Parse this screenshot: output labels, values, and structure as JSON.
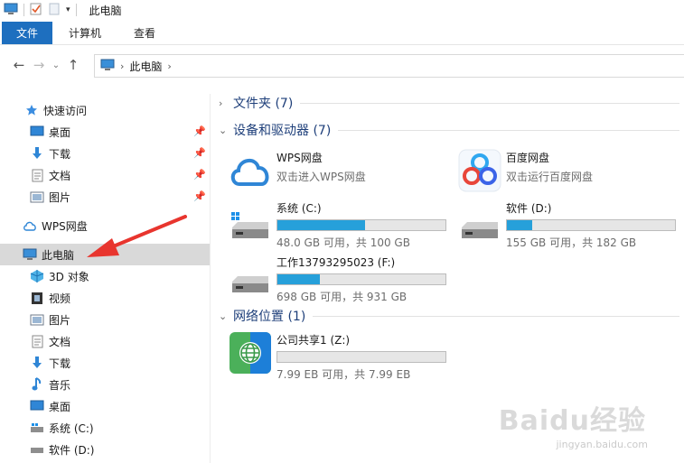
{
  "window": {
    "title": "此电脑"
  },
  "ribbon": {
    "tabs": [
      "文件",
      "计算机",
      "查看"
    ]
  },
  "address": {
    "crumb": "此电脑"
  },
  "sidebar": {
    "quick_access": "快速访问",
    "quick_items": [
      {
        "label": "桌面",
        "icon": "desktop-icon"
      },
      {
        "label": "下载",
        "icon": "download-icon"
      },
      {
        "label": "文档",
        "icon": "document-icon"
      },
      {
        "label": "图片",
        "icon": "pictures-icon"
      }
    ],
    "wps": "WPS网盘",
    "this_pc": "此电脑",
    "pc_items": [
      {
        "label": "3D 对象",
        "icon": "3d-objects-icon"
      },
      {
        "label": "视频",
        "icon": "video-icon"
      },
      {
        "label": "图片",
        "icon": "pictures-icon"
      },
      {
        "label": "文档",
        "icon": "document-icon"
      },
      {
        "label": "下载",
        "icon": "download-icon"
      },
      {
        "label": "音乐",
        "icon": "music-icon"
      },
      {
        "label": "桌面",
        "icon": "desktop-icon"
      },
      {
        "label": "系统 (C:)",
        "icon": "drive-icon"
      },
      {
        "label": "软件 (D:)",
        "icon": "drive-icon"
      }
    ]
  },
  "main": {
    "folders_head": "文件夹 (7)",
    "devices_head": "设备和驱动器 (7)",
    "network_head": "网络位置 (1)",
    "apps": [
      {
        "name": "WPS网盘",
        "sub": "双击进入WPS网盘"
      },
      {
        "name": "百度网盘",
        "sub": "双击运行百度网盘"
      }
    ],
    "drives": [
      {
        "name": "系统 (C:)",
        "free": "48.0 GB 可用，共 100 GB",
        "used_fraction": 0.52
      },
      {
        "name": "软件 (D:)",
        "free": "155 GB 可用，共 182 GB",
        "used_fraction": 0.15
      },
      {
        "name": "工作13793295023 (F:)",
        "free": "698 GB 可用，共 931 GB",
        "used_fraction": 0.25
      }
    ],
    "network": [
      {
        "name": "公司共享1 (Z:)",
        "free": "7.99 EB 可用，共 7.99 EB",
        "used_fraction": 0.0
      }
    ]
  },
  "colors": {
    "accent": "#1e6fbf",
    "bar_fill": "#26a0da",
    "annotation": "#e8352e"
  },
  "watermark": {
    "brand": "Baidu经验",
    "url": "jingyan.baidu.com"
  }
}
